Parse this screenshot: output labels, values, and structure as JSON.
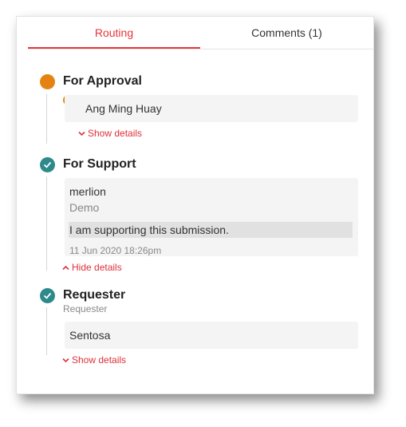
{
  "tabs": {
    "routing": "Routing",
    "comments": "Comments (1)"
  },
  "stages": {
    "approval": {
      "title": "For Approval",
      "assignee": "Ang Ming Huay",
      "toggle": "Show details"
    },
    "support": {
      "title": "For Support",
      "user": "merlion",
      "org": "Demo",
      "comment": "I am supporting this submission.",
      "timestamp": "11 Jun 2020 18:26pm",
      "toggle": "Hide details"
    },
    "requester": {
      "title": "Requester",
      "subtitle": "Requester",
      "name": "Sentosa",
      "toggle": "Show details"
    }
  },
  "colors": {
    "accent": "#e8353b",
    "pending": "#e58312",
    "done": "#2e8a8a"
  },
  "icons": {
    "pending": "circle-icon",
    "done": "check-icon",
    "expand": "chevron-down-icon",
    "collapse": "chevron-up-icon"
  }
}
